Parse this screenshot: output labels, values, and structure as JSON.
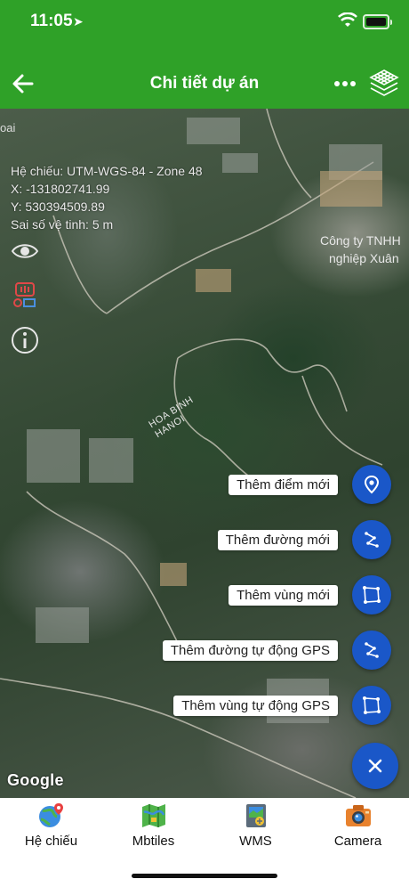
{
  "status": {
    "time": "11:05"
  },
  "header": {
    "title": "Chi tiết dự án"
  },
  "map": {
    "info": {
      "projection": "Hệ chiếu: UTM-WGS-84 - Zone 48",
      "x": "X: -131802741.99",
      "y": "Y: 530394509.89",
      "accuracy": "Sai số vệ tinh: 5 m"
    },
    "labels": {
      "area_line1": "HOA BINH",
      "area_line2": "HANOI",
      "company_line1": "Công ty TNHH",
      "company_line2": "nghiệp Xuân",
      "top_left_fragment": "oai"
    },
    "attribution": "Google"
  },
  "fab_menu": {
    "add_point": "Thêm điểm mới",
    "add_line": "Thêm đường mới",
    "add_area": "Thêm vùng mới",
    "add_line_gps": "Thêm đường tự động GPS",
    "add_area_gps": "Thêm vùng tự động GPS"
  },
  "bottom_nav": {
    "projection": "Hệ chiếu",
    "mbtiles": "Mbtiles",
    "wms": "WMS",
    "camera": "Camera"
  },
  "colors": {
    "header_green": "#2fa128",
    "fab_blue": "#1a57c8"
  }
}
